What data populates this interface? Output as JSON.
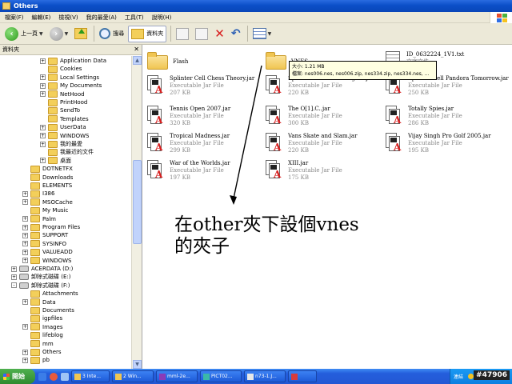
{
  "window": {
    "title": "Others"
  },
  "menu": [
    "檔案(F)",
    "編輯(E)",
    "檢視(V)",
    "我的最愛(A)",
    "工具(T)",
    "說明(H)"
  ],
  "toolbar": {
    "back": "上一頁",
    "search": "搜尋",
    "folders": "資料夾"
  },
  "folderpane": {
    "title": "資料夾",
    "items": [
      {
        "label": "Application Data",
        "indent": 1,
        "expander": "+"
      },
      {
        "label": "Cookies",
        "indent": 1,
        "expander": ""
      },
      {
        "label": "Local Settings",
        "indent": 1,
        "expander": "+"
      },
      {
        "label": "My Documents",
        "indent": 1,
        "expander": "+"
      },
      {
        "label": "NetHood",
        "indent": 1,
        "expander": "+"
      },
      {
        "label": "PrintHood",
        "indent": 1,
        "expander": ""
      },
      {
        "label": "SendTo",
        "indent": 1,
        "expander": ""
      },
      {
        "label": "Templates",
        "indent": 1,
        "expander": ""
      },
      {
        "label": "UserData",
        "indent": 1,
        "expander": "+"
      },
      {
        "label": "WINDOWS",
        "indent": 1,
        "expander": "+"
      },
      {
        "label": "我的最愛",
        "indent": 1,
        "expander": "+"
      },
      {
        "label": "我最近的文件",
        "indent": 1,
        "expander": ""
      },
      {
        "label": "桌面",
        "indent": 1,
        "expander": "+"
      },
      {
        "label": "DOTNETFX",
        "indent": 0,
        "expander": ""
      },
      {
        "label": "Downloads",
        "indent": 0,
        "expander": ""
      },
      {
        "label": "ELEMENTS",
        "indent": 0,
        "expander": ""
      },
      {
        "label": "I386",
        "indent": 0,
        "expander": "+"
      },
      {
        "label": "MSOCache",
        "indent": 0,
        "expander": "+"
      },
      {
        "label": "My Music",
        "indent": 0,
        "expander": ""
      },
      {
        "label": "Palm",
        "indent": 0,
        "expander": "+"
      },
      {
        "label": "Program Files",
        "indent": 0,
        "expander": "+"
      },
      {
        "label": "SUPPORT",
        "indent": 0,
        "expander": "+"
      },
      {
        "label": "SYSINFO",
        "indent": 0,
        "expander": "+"
      },
      {
        "label": "VALUEADD",
        "indent": 0,
        "expander": "+"
      },
      {
        "label": "WINDOWS",
        "indent": 0,
        "expander": "+"
      },
      {
        "label": "ACERDATA (D:)",
        "indent": -1,
        "expander": "+",
        "drive": true
      },
      {
        "label": "卸除式磁碟 (E:)",
        "indent": -1,
        "expander": "+",
        "drive": true
      },
      {
        "label": "卸除式磁碟 (F:)",
        "indent": -1,
        "expander": "-",
        "drive": true
      },
      {
        "label": "Attachments",
        "indent": 0,
        "expander": ""
      },
      {
        "label": "Data",
        "indent": 0,
        "expander": "+"
      },
      {
        "label": "Documents",
        "indent": 0,
        "expander": ""
      },
      {
        "label": "igpfiles",
        "indent": 0,
        "expander": ""
      },
      {
        "label": "Images",
        "indent": 0,
        "expander": "+"
      },
      {
        "label": "lifeblog",
        "indent": 0,
        "expander": ""
      },
      {
        "label": "mm",
        "indent": 0,
        "expander": ""
      },
      {
        "label": "Others",
        "indent": 0,
        "expander": "+"
      },
      {
        "label": "pb",
        "indent": 0,
        "expander": "+"
      }
    ]
  },
  "files": [
    {
      "name": "Flash",
      "kind": "folder"
    },
    {
      "name": "VNES",
      "kind": "folder"
    },
    {
      "name": "ID_0632224_1V1.txt",
      "type": "文字文件",
      "size": "1 KB",
      "kind": "txt"
    },
    {
      "name": "Splinter Cell Chess Theory.jar",
      "type": "Executable Jar File",
      "size": "207 KB",
      "kind": "jar"
    },
    {
      "name": "Splinter Cell Double Agent.jar",
      "type": "Executable Jar File",
      "size": "220 KB",
      "kind": "jar"
    },
    {
      "name": "Splinter Cell Pandora Tomorrow.jar",
      "type": "Executable Jar File",
      "size": "250 KB",
      "kind": "jar"
    },
    {
      "name": "Tennis Open 2007.jar",
      "type": "Executable Jar File",
      "size": "320 KB",
      "kind": "jar"
    },
    {
      "name": "The O[1].C..jar",
      "type": "Executable Jar File",
      "size": "300 KB",
      "kind": "jar"
    },
    {
      "name": "Totally Spies.jar",
      "type": "Executable Jar File",
      "size": "286 KB",
      "kind": "jar"
    },
    {
      "name": "Tropical Madness.jar",
      "type": "Executable Jar File",
      "size": "299 KB",
      "kind": "jar"
    },
    {
      "name": "Vans Skate and Slam.jar",
      "type": "Executable Jar File",
      "size": "220 KB",
      "kind": "jar"
    },
    {
      "name": "Vijay Singh Pro Golf 2005.jar",
      "type": "Executable Jar File",
      "size": "195 KB",
      "kind": "jar"
    },
    {
      "name": "War of the Worlds.jar",
      "type": "Executable Jar File",
      "size": "197 KB",
      "kind": "jar"
    },
    {
      "name": "XIII.jar",
      "type": "Executable Jar File",
      "size": "175 KB",
      "kind": "jar"
    }
  ],
  "tooltip": {
    "line1": "大小: 1.21 MB",
    "line2": "檔案: nes006.nes, nes006.zip, nes334.zip, nes334.nes, ..."
  },
  "annotation": {
    "line1": "在other夾下設個vnes",
    "line2": "的夾子"
  },
  "taskbar": {
    "start": "開始",
    "tasks": [
      "3 Inte...",
      "2 Win...",
      "mml-2e...",
      "PICT02...",
      "n73-1.J...",
      ""
    ],
    "tray": "連結"
  },
  "watermark": "#47906"
}
